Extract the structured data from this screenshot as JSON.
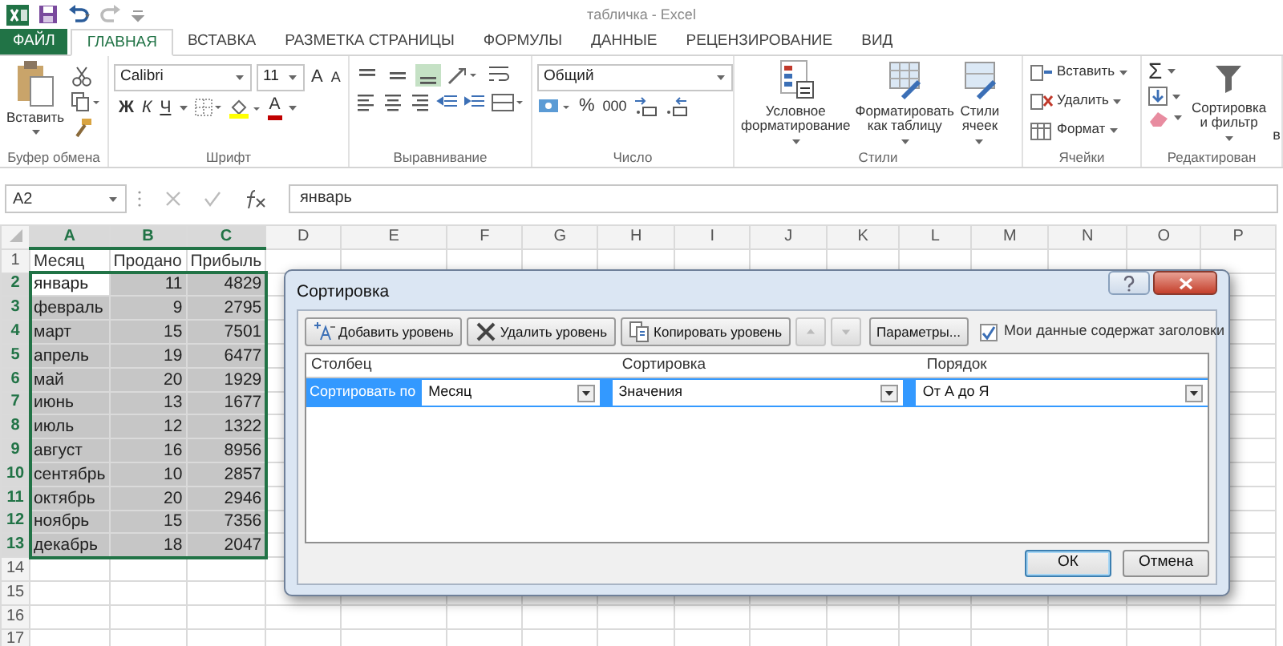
{
  "window": {
    "title": "табличка - Excel"
  },
  "tabs": [
    {
      "label": "ФАЙЛ",
      "kind": "file",
      "selected": false
    },
    {
      "label": "ГЛАВНАЯ",
      "kind": "tab",
      "selected": true
    },
    {
      "label": "ВСТАВКА",
      "kind": "tab",
      "selected": false
    },
    {
      "label": "РАЗМЕТКА СТРАНИЦЫ",
      "kind": "tab",
      "selected": false
    },
    {
      "label": "ФОРМУЛЫ",
      "kind": "tab",
      "selected": false
    },
    {
      "label": "ДАННЫЕ",
      "kind": "tab",
      "selected": false
    },
    {
      "label": "РЕЦЕНЗИРОВАНИЕ",
      "kind": "tab",
      "selected": false
    },
    {
      "label": "ВИД",
      "kind": "tab",
      "selected": false
    }
  ],
  "ribbon": [
    {
      "kind": "clipboard",
      "label": "Буфер обмена",
      "paste": "Вставить"
    },
    {
      "kind": "font",
      "label": "Шрифт",
      "font": "Calibri",
      "size": "11",
      "grow": "A",
      "shrink": "A",
      "styles": [
        "Ж",
        "К",
        "Ч"
      ],
      "font_color": "A"
    },
    {
      "kind": "alignment",
      "label": "Выравнивание",
      "vertical": [
        {
          "on": false
        },
        {
          "on": false
        },
        {
          "on": true
        }
      ]
    },
    {
      "kind": "number",
      "label": "Число",
      "format": "Общий",
      "percent": "%",
      "thousands": "000"
    },
    {
      "kind": "styles",
      "label": "Стили",
      "buttons": [
        {
          "lines": [
            "Условное",
            "форматирование"
          ]
        },
        {
          "lines": [
            "Форматировать",
            "как таблицу"
          ]
        },
        {
          "lines": [
            "Стили",
            "ячеек"
          ]
        }
      ]
    },
    {
      "kind": "cells",
      "label": "Ячейки",
      "buttons": [
        "Вставить",
        "Удалить",
        "Формат"
      ]
    },
    {
      "kind": "editing",
      "label": "Редактирован",
      "sum": "Σ",
      "sort": [
        "Сортировка",
        "и фильтр"
      ],
      "find": "в"
    }
  ],
  "formula_bar": {
    "name_box": "A2",
    "formula": "январь"
  },
  "sheet": {
    "columns": [
      {
        "label": "A",
        "selected": true
      },
      {
        "label": "B",
        "selected": true
      },
      {
        "label": "C",
        "selected": true
      },
      {
        "label": "D",
        "selected": false
      },
      {
        "label": "E",
        "selected": false
      },
      {
        "label": "F",
        "selected": false
      },
      {
        "label": "G",
        "selected": false
      },
      {
        "label": "H",
        "selected": false
      },
      {
        "label": "I",
        "selected": false
      },
      {
        "label": "J",
        "selected": false
      },
      {
        "label": "K",
        "selected": false
      },
      {
        "label": "L",
        "selected": false
      },
      {
        "label": "M",
        "selected": false
      },
      {
        "label": "N",
        "selected": false
      },
      {
        "label": "O",
        "selected": false
      },
      {
        "label": "P",
        "selected": false
      }
    ],
    "rows": [
      {
        "number": "1",
        "selected": false,
        "cells": [
          {
            "text": "Месяц",
            "kind": "text",
            "active": false
          },
          {
            "text": "Продано",
            "kind": "text",
            "active": false
          },
          {
            "text": "Прибыль",
            "kind": "text",
            "active": false
          }
        ]
      },
      {
        "number": "2",
        "selected": true,
        "cells": [
          {
            "text": "январь",
            "kind": "text",
            "active": true
          },
          {
            "text": "11",
            "kind": "number",
            "active": false
          },
          {
            "text": "4829",
            "kind": "number",
            "active": false
          }
        ]
      },
      {
        "number": "3",
        "selected": true,
        "cells": [
          {
            "text": "февраль",
            "kind": "text",
            "active": false
          },
          {
            "text": "9",
            "kind": "number",
            "active": false
          },
          {
            "text": "2795",
            "kind": "number",
            "active": false
          }
        ]
      },
      {
        "number": "4",
        "selected": true,
        "cells": [
          {
            "text": "март",
            "kind": "text",
            "active": false
          },
          {
            "text": "15",
            "kind": "number",
            "active": false
          },
          {
            "text": "7501",
            "kind": "number",
            "active": false
          }
        ]
      },
      {
        "number": "5",
        "selected": true,
        "cells": [
          {
            "text": "апрель",
            "kind": "text",
            "active": false
          },
          {
            "text": "19",
            "kind": "number",
            "active": false
          },
          {
            "text": "6477",
            "kind": "number",
            "active": false
          }
        ]
      },
      {
        "number": "6",
        "selected": true,
        "cells": [
          {
            "text": "май",
            "kind": "text",
            "active": false
          },
          {
            "text": "20",
            "kind": "number",
            "active": false
          },
          {
            "text": "1929",
            "kind": "number",
            "active": false
          }
        ]
      },
      {
        "number": "7",
        "selected": true,
        "cells": [
          {
            "text": "июнь",
            "kind": "text",
            "active": false
          },
          {
            "text": "13",
            "kind": "number",
            "active": false
          },
          {
            "text": "1677",
            "kind": "number",
            "active": false
          }
        ]
      },
      {
        "number": "8",
        "selected": true,
        "cells": [
          {
            "text": "июль",
            "kind": "text",
            "active": false
          },
          {
            "text": "12",
            "kind": "number",
            "active": false
          },
          {
            "text": "1322",
            "kind": "number",
            "active": false
          }
        ]
      },
      {
        "number": "9",
        "selected": true,
        "cells": [
          {
            "text": "август",
            "kind": "text",
            "active": false
          },
          {
            "text": "16",
            "kind": "number",
            "active": false
          },
          {
            "text": "8956",
            "kind": "number",
            "active": false
          }
        ]
      },
      {
        "number": "10",
        "selected": true,
        "cells": [
          {
            "text": "сентябрь",
            "kind": "text",
            "active": false
          },
          {
            "text": "10",
            "kind": "number",
            "active": false
          },
          {
            "text": "2857",
            "kind": "number",
            "active": false
          }
        ]
      },
      {
        "number": "11",
        "selected": true,
        "cells": [
          {
            "text": "октябрь",
            "kind": "text",
            "active": false
          },
          {
            "text": "20",
            "kind": "number",
            "active": false
          },
          {
            "text": "2946",
            "kind": "number",
            "active": false
          }
        ]
      },
      {
        "number": "12",
        "selected": true,
        "cells": [
          {
            "text": "ноябрь",
            "kind": "text",
            "active": false
          },
          {
            "text": "15",
            "kind": "number",
            "active": false
          },
          {
            "text": "7356",
            "kind": "number",
            "active": false
          }
        ]
      },
      {
        "number": "13",
        "selected": true,
        "cells": [
          {
            "text": "декабрь",
            "kind": "text",
            "active": false
          },
          {
            "text": "18",
            "kind": "number",
            "active": false
          },
          {
            "text": "2047",
            "kind": "number",
            "active": false
          }
        ]
      },
      {
        "number": "14",
        "selected": false
      },
      {
        "number": "15",
        "selected": false
      },
      {
        "number": "16",
        "selected": false
      },
      {
        "number": "17",
        "selected": false
      }
    ]
  },
  "dialog": {
    "title": "Сортировка",
    "toolbar": [
      {
        "kind": "add",
        "label": "Добавить уровень",
        "disabled": false
      },
      {
        "kind": "delete",
        "label": "Удалить уровень",
        "disabled": false
      },
      {
        "kind": "copy",
        "label": "Копировать уровень",
        "disabled": false
      },
      {
        "kind": "up",
        "disabled": true
      },
      {
        "kind": "down",
        "disabled": true
      },
      {
        "kind": "options",
        "label": "Параметры...",
        "disabled": false
      }
    ],
    "headers_checkbox": {
      "label": "Мои данные содержат заголовки",
      "checked": true
    },
    "columns": [
      "Столбец",
      "Сортировка",
      "Порядок"
    ],
    "levels": [
      {
        "label": "Сортировать по",
        "selected": true,
        "column": "Месяц",
        "sort_on": "Значения",
        "order": "От А до Я"
      }
    ],
    "buttons": [
      "ОК",
      "Отмена"
    ]
  }
}
